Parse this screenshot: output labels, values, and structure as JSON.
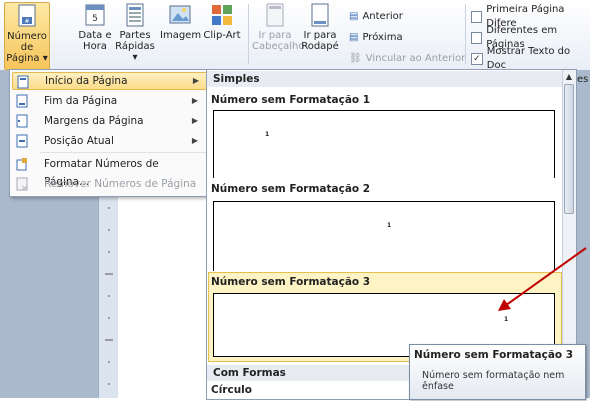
{
  "ribbon": {
    "numero_pagina": "Número de\nPágina",
    "numero_pagina_l1": "Número de",
    "numero_pagina_l2": "Página",
    "data_hora_l1": "Data e",
    "data_hora_l2": "Hora",
    "partes_l1": "Partes",
    "partes_l2": "Rápidas",
    "imagem": "Imagem",
    "clipart": "Clip-Art",
    "ir_cabecalho_l1": "Ir para",
    "ir_cabecalho_l2": "Cabeçalho",
    "ir_rodape_l1": "Ir para",
    "ir_rodape_l2": "Rodapé",
    "anterior": "Anterior",
    "proxima": "Próxima",
    "vincular": "Vincular ao Anterior",
    "primeira_pagina": "Primeira Página Difere",
    "diferentes_paginas": "Diferentes em Páginas",
    "mostrar_texto": "Mostrar Texto do Doc",
    "es_fragment": "es"
  },
  "menu": {
    "items": [
      {
        "label": "Início da Página",
        "arrow": "▶"
      },
      {
        "label": "Fim da Página",
        "arrow": "▶"
      },
      {
        "label": "Margens da Página",
        "arrow": "▶"
      },
      {
        "label": "Posição Atual",
        "arrow": "▶"
      },
      {
        "label": "Formatar Números de Página..."
      },
      {
        "label": "Remover Números de Página"
      }
    ]
  },
  "gallery": {
    "section_simples": "Simples",
    "item1_title": "Número sem Formatação 1",
    "item2_title": "Número sem Formatação 2",
    "item3_title": "Número sem Formatação 3",
    "page_number": "1",
    "section_formas": "Com Formas",
    "item_circulo": "Círculo"
  },
  "tooltip": {
    "title": "Número sem Formatação 3",
    "desc": "Número sem formatação nem ênfase"
  },
  "colors": {
    "highlight": "#fbdc8a",
    "arrow": "#c00000"
  }
}
